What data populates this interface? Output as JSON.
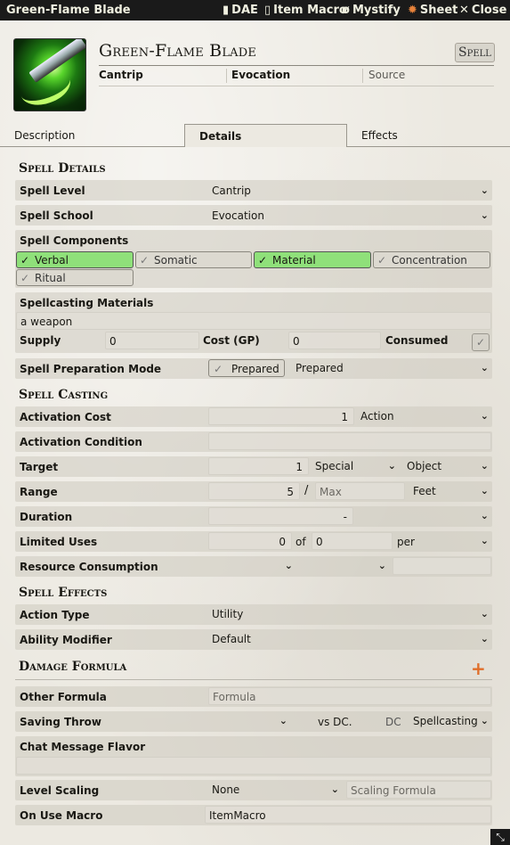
{
  "window": {
    "title": "Green-Flame Blade",
    "header_buttons": [
      {
        "icon": "document-icon",
        "label": "DAE"
      },
      {
        "icon": "scroll-icon",
        "label": "Item Macro"
      },
      {
        "icon": "eye-slash-icon",
        "label": "Mystify"
      },
      {
        "icon": "gear-icon",
        "label": "Sheet"
      },
      {
        "icon": "close-icon",
        "label": "Close"
      }
    ]
  },
  "item": {
    "name": "Green-Flame Blade",
    "type_badge": "Spell",
    "summary": {
      "level": "Cantrip",
      "school": "Evocation",
      "source_placeholder": "Source"
    }
  },
  "tabs": [
    "Description",
    "Details",
    "Effects"
  ],
  "active_tab": "Details",
  "spell_details": {
    "heading": "Spell Details",
    "spell_level_label": "Spell Level",
    "spell_level_value": "Cantrip",
    "spell_school_label": "Spell School",
    "spell_school_value": "Evocation",
    "components_label": "Spell Components",
    "components": [
      {
        "label": "Verbal",
        "checked": true
      },
      {
        "label": "Somatic",
        "checked": false
      },
      {
        "label": "Material",
        "checked": true
      },
      {
        "label": "Concentration",
        "checked": false
      },
      {
        "label": "Ritual",
        "checked": false
      }
    ],
    "materials_label": "Spellcasting Materials",
    "materials_value": "a weapon",
    "supply_label": "Supply",
    "supply_value": "0",
    "cost_label": "Cost (GP)",
    "cost_value": "0",
    "consumed_label": "Consumed",
    "consumed_checked": true,
    "prep_mode_label": "Spell Preparation Mode",
    "prepared_toggle_label": "Prepared",
    "prep_mode_value": "Prepared"
  },
  "spell_casting": {
    "heading": "Spell Casting",
    "activation_cost_label": "Activation Cost",
    "activation_cost_value": "1",
    "activation_type_value": "Action",
    "activation_condition_label": "Activation Condition",
    "activation_condition_value": "",
    "target_label": "Target",
    "target_value": "1",
    "target_units": "Special",
    "target_type": "Object",
    "range_label": "Range",
    "range_value": "5",
    "range_sep": "/",
    "range_max_placeholder": "Max",
    "range_units": "Feet",
    "duration_label": "Duration",
    "duration_value": "-",
    "duration_units": "",
    "limited_uses_label": "Limited Uses",
    "uses_value": "0",
    "uses_of": "of",
    "uses_max": "0",
    "uses_per": "per",
    "uses_period": "",
    "resource_label": "Resource Consumption"
  },
  "spell_effects": {
    "heading": "Spell Effects",
    "action_type_label": "Action Type",
    "action_type_value": "Utility",
    "ability_mod_label": "Ability Modifier",
    "ability_mod_value": "Default"
  },
  "damage": {
    "heading": "Damage Formula",
    "add_icon": "plus-icon",
    "other_formula_label": "Other Formula",
    "other_formula_placeholder": "Formula",
    "saving_throw_label": "Saving Throw",
    "vs_dc": "vs DC.",
    "dc_label": "DC",
    "dc_source": "Spellcasting",
    "chat_flavor_label": "Chat Message Flavor",
    "chat_flavor_value": "",
    "level_scaling_label": "Level Scaling",
    "level_scaling_value": "None",
    "scaling_formula_placeholder": "Scaling Formula",
    "on_use_macro_label": "On Use Macro",
    "on_use_macro_value": "ItemMacro"
  },
  "colors": {
    "titlebar": "#1a1a1a",
    "checked_component": "#8fe07a",
    "plus_accent": "#e06e2a"
  }
}
